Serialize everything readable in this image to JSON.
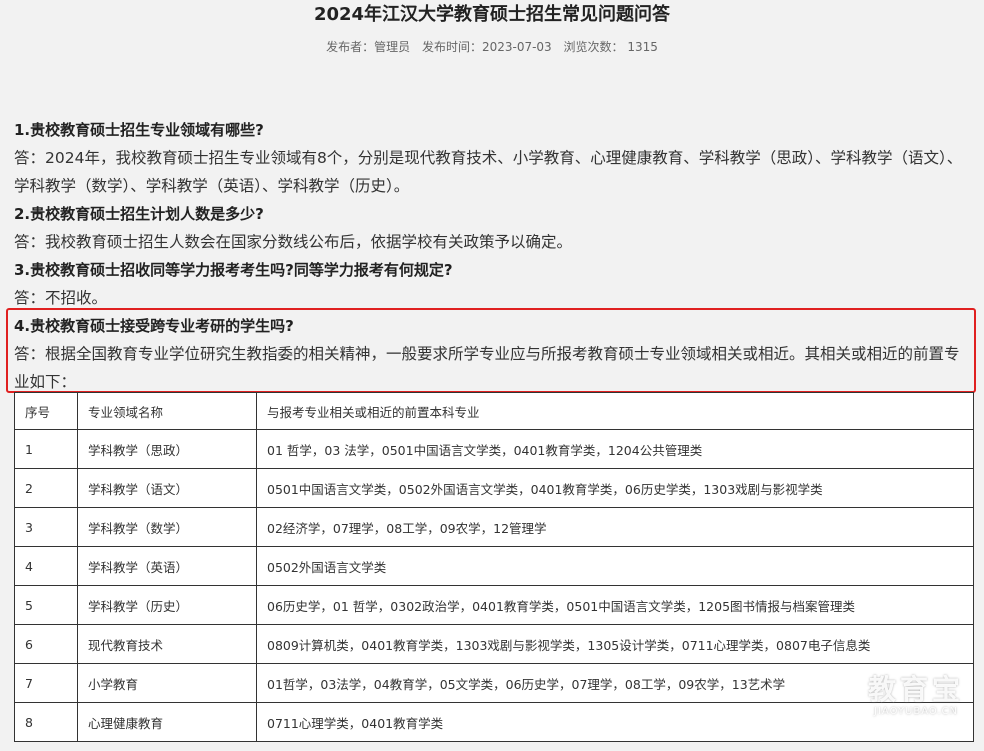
{
  "article": {
    "title": "2024年江汉大学教育硕士招生常见问题问答",
    "meta": {
      "publisher": "发布者：管理员",
      "publish_time": "发布时间：2023-07-03",
      "views": "浏览次数：  1315"
    }
  },
  "faq": [
    {
      "question": "1.贵校教育硕士招生专业领域有哪些?",
      "answer": "答：2024年，我校教育硕士招生专业领域有8个，分别是现代教育技术、小学教育、心理健康教育、学科教学（思政）、学科教学（语文）、学科教学（数学）、学科教学（英语）、学科教学（历史）。"
    },
    {
      "question": "2.贵校教育硕士招生计划人数是多少?",
      "answer": "答：我校教育硕士招生人数会在国家分数线公布后，依据学校有关政策予以确定。"
    },
    {
      "question": "3.贵校教育硕士招收同等学力报考考生吗?同等学力报考有何规定?",
      "answer": "答：不招收。"
    },
    {
      "question": "4.贵校教育硕士接受跨专业考研的学生吗?",
      "answer": "答：根据全国教育专业学位研究生教指委的相关精神，一般要求所学专业应与所报考教育硕士专业领域相关或相近。其相关或相近的前置专业如下："
    }
  ],
  "table": {
    "headers": [
      "序号",
      "专业领域名称",
      "与报考专业相关或相近的前置本科专业"
    ],
    "rows": [
      [
        "1",
        "学科教学（思政）",
        "01 哲学，03 法学，0501中国语言文学类，0401教育学类，1204公共管理类"
      ],
      [
        "2",
        "学科教学（语文）",
        "0501中国语言文学类，0502外国语言文学类，0401教育学类，06历史学类，1303戏剧与影视学类"
      ],
      [
        "3",
        "学科教学（数学）",
        "02经济学，07理学，08工学，09农学，12管理学"
      ],
      [
        "4",
        "学科教学（英语）",
        "0502外国语言文学类"
      ],
      [
        "5",
        "学科教学（历史）",
        "06历史学，01 哲学，0302政治学，0401教育学类，0501中国语言文学类，1205图书情报与档案管理类"
      ],
      [
        "6",
        "现代教育技术",
        "0809计算机类，0401教育学类，1303戏剧与影视学类，1305设计学类，0711心理学类，0807电子信息类"
      ],
      [
        "7",
        "小学教育",
        "01哲学，03法学，04教育学，05文学类，06历史学，07理学，08工学，09农学，13艺术学"
      ],
      [
        "8",
        "心理健康教育",
        "0711心理学类，0401教育学类"
      ]
    ]
  },
  "watermark": {
    "cn": "教育宝",
    "en": "JIAOYUBAO.CN"
  },
  "colors": {
    "highlight_border": "#e02020",
    "page_background": "#f2f2f2"
  }
}
